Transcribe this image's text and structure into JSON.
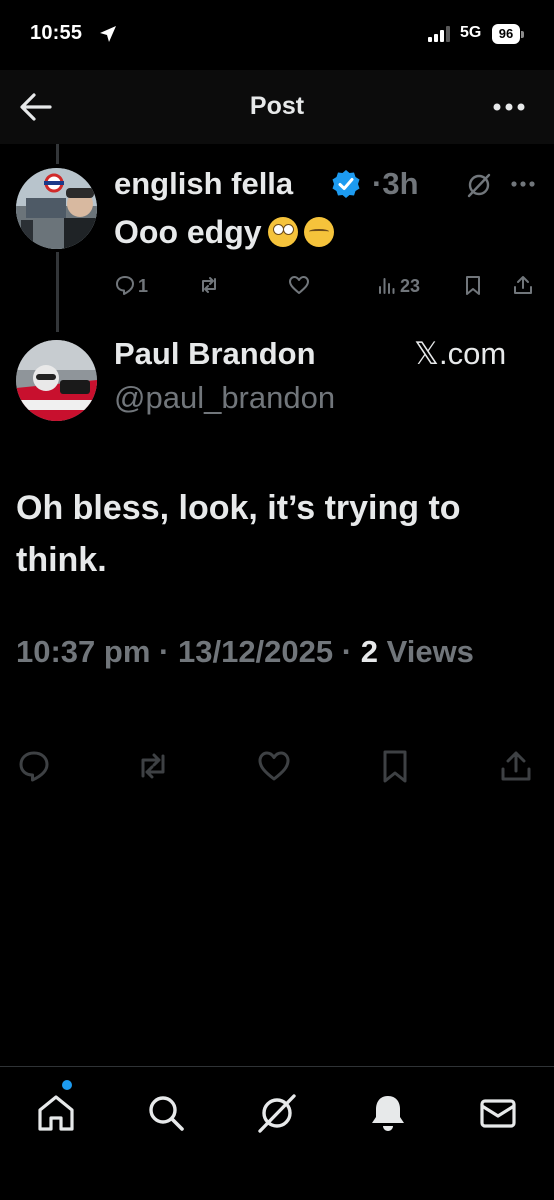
{
  "status_bar": {
    "time": "10:55",
    "network": "5G",
    "battery": "96"
  },
  "header": {
    "title": "Post"
  },
  "reply": {
    "author_name": "english fella",
    "timestamp": "3h",
    "separator": "·",
    "text": "Ooo edgy",
    "emojis": [
      "face-with-rolling-eyes",
      "sleeping-face"
    ],
    "replies": "1",
    "reposts": "",
    "likes": "",
    "views": "23"
  },
  "post": {
    "author_name": "Paul Brandon",
    "handle": "@paul_brandon",
    "xcom": "𝕏.com",
    "text": "Oh bless, look, it’s trying to think.",
    "time": "10:37 pm",
    "date": "13/12/2025",
    "views_count": "2",
    "views_label": "Views",
    "sep": "·"
  },
  "colors": {
    "background": "#000000",
    "text_primary": "#e7e9ea",
    "text_secondary": "#71767b",
    "verified": "#1d9bf0"
  },
  "icons": {
    "status": [
      "location-arrow-icon",
      "signal-icon",
      "battery-icon"
    ],
    "header": [
      "back-arrow-icon",
      "more-horizontal-icon"
    ],
    "nav": [
      "home-icon",
      "search-icon",
      "grok-icon",
      "notifications-bell-icon",
      "messages-mail-icon"
    ]
  }
}
